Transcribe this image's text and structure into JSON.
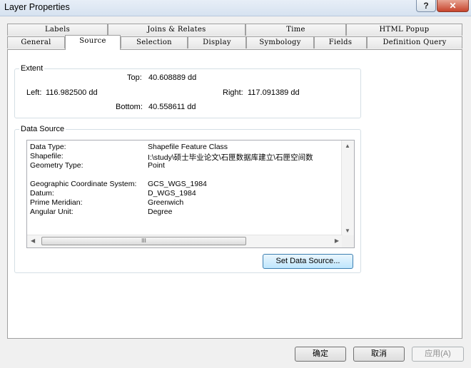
{
  "window": {
    "title": "Layer Properties",
    "help_label": "?",
    "close_label": "✕"
  },
  "tabs_row1": [
    "Labels",
    "Joins & Relates",
    "Time",
    "HTML Popup"
  ],
  "tabs_row2": [
    "General",
    "Source",
    "Selection",
    "Display",
    "Symbology",
    "Fields",
    "Definition Query"
  ],
  "extent": {
    "legend": "Extent",
    "top_label": "Top:",
    "top_value": "40.608889 dd",
    "left_label": "Left:",
    "left_value": "116.982500 dd",
    "right_label": "Right:",
    "right_value": "117.091389 dd",
    "bottom_label": "Bottom:",
    "bottom_value": "40.558611 dd"
  },
  "data_source": {
    "legend": "Data Source",
    "rows": [
      {
        "label": "Data Type:",
        "value": "Shapefile Feature Class"
      },
      {
        "label": "Shapefile:",
        "value": "I:\\study\\硕士毕业论文\\石匣数据库建立\\石匣空间数"
      },
      {
        "label": "Geometry Type:",
        "value": "Point"
      },
      {
        "label": "Geographic Coordinate System:",
        "value": "GCS_WGS_1984"
      },
      {
        "label": "Datum:",
        "value": "D_WGS_1984"
      },
      {
        "label": "Prime Meridian:",
        "value": "Greenwich"
      },
      {
        "label": "Angular Unit:",
        "value": "Degree"
      }
    ],
    "thumb_label": "III",
    "set_button": "Set Data Source..."
  },
  "buttons": {
    "ok": "确定",
    "cancel": "取消",
    "apply": "应用(A)"
  }
}
